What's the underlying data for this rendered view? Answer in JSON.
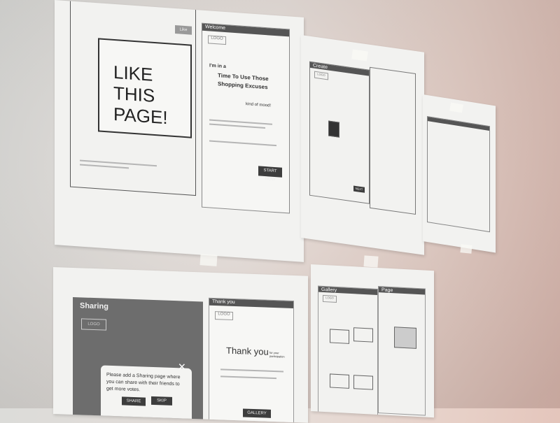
{
  "posters": {
    "like_page": {
      "bubble_text": "LIKE THIS PAGE!",
      "like_button": "Like"
    },
    "welcome": {
      "header": "Welcome",
      "logo": "LOGO",
      "headline_line1": "I'm in a",
      "headline_line2": "Time To Use Those",
      "headline_line3": "Shopping Excuses",
      "tagline": "kind of mood!",
      "cta": "START NOW"
    },
    "create": {
      "header": "Create",
      "logo": "LOGO",
      "next": "NEXT"
    },
    "sharing": {
      "header": "Sharing",
      "logo": "LOGO",
      "popup_line1": "Please add a Sharing page where",
      "popup_line2": "you can share with their friends to",
      "popup_line3": "get more votes.",
      "share": "SHARE",
      "skip": "SKIP"
    },
    "thank_you": {
      "header": "Thank you",
      "logo": "LOGO",
      "heading": "Thank you",
      "heading_small": "for your participation",
      "gallery_button": "GALLERY"
    },
    "gallery": {
      "header": "Gallery",
      "page_header": "Page",
      "logo": "LOGO"
    }
  }
}
